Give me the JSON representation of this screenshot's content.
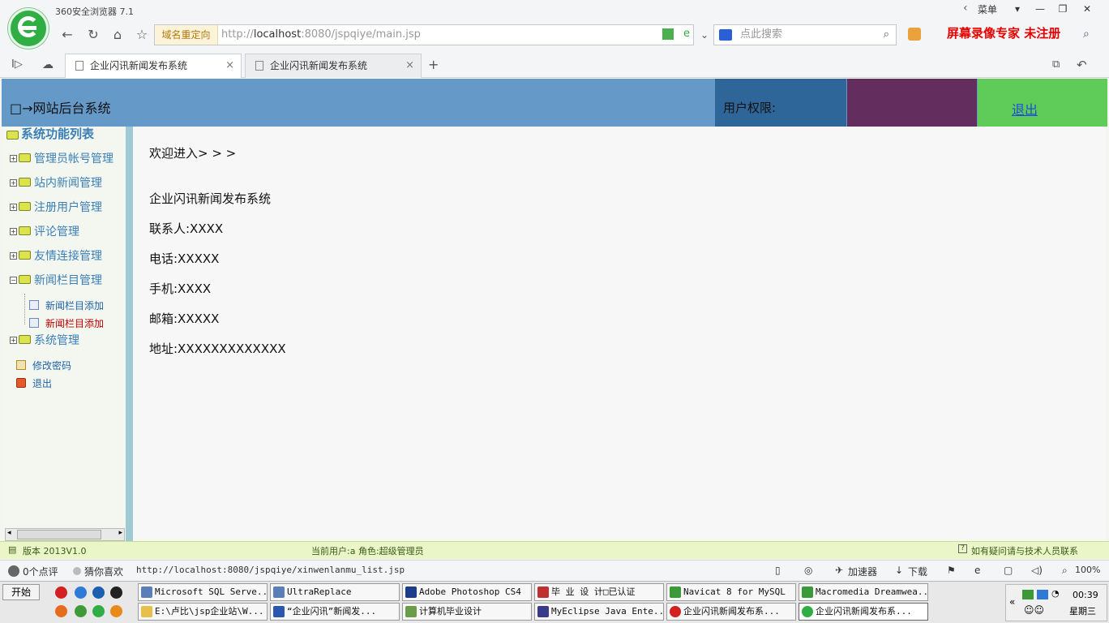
{
  "browser": {
    "app_title": "360安全浏览器 7.1",
    "menu_label": "菜单",
    "recorder_watermark": "屏幕录像专家 未注册",
    "redirect_label": "域名重定向",
    "url_prefix": "http://",
    "url_host": "localhost",
    "url_rest": ":8080/jspqiye/main.jsp",
    "search_placeholder": "点此搜索",
    "tabs": [
      {
        "label": "企业闪讯新闻发布系统",
        "active": true
      },
      {
        "label": "企业闪讯新闻发布系统",
        "active": false
      }
    ]
  },
  "header": {
    "system_title": "□→网站后台系统",
    "rights_label": "用户权限:",
    "logout_label": "退出"
  },
  "sidebar": {
    "root_label": "系统功能列表",
    "items": [
      {
        "label": "管理员帐号管理"
      },
      {
        "label": "站内新闻管理"
      },
      {
        "label": "注册用户管理"
      },
      {
        "label": "评论管理"
      },
      {
        "label": "友情连接管理"
      },
      {
        "label": "新闻栏目管理"
      }
    ],
    "subitems": [
      {
        "label": "新闻栏目添加"
      },
      {
        "label": "新闻栏目添加"
      }
    ],
    "system_item": "系统管理",
    "change_password": "修改密码",
    "exit": "退出"
  },
  "main": {
    "welcome": "欢迎进入> > >",
    "company": "企业闪讯新闻发布系统",
    "contact": "联系人:XXXX",
    "phone": "电话:XXXXX",
    "mobile": "手机:XXXX",
    "email": "邮箱:XXXXX",
    "address": "地址:XXXXXXXXXXXXX"
  },
  "footer": {
    "version": "版本 2013V1.0",
    "current_user": "当前用户:a  角色:超级管理员",
    "help": "如有疑问请与技术人员联系"
  },
  "statusbar": {
    "likes": "0个点评",
    "guess": "猜你喜欢",
    "hover_url": "http://localhost:8080/jspqiye/xinwenlanmu_list.jsp",
    "accelerator": "加速器",
    "download": "下载",
    "zoom": "100%"
  },
  "taskbar": {
    "start": "开始",
    "items": [
      "Microsoft SQL Serve...",
      "UltraReplace",
      "Adobe Photoshop CS4",
      "毕 业 设 计□已认证",
      "Navicat 8 for MySQL",
      "Macromedia Dreamwea...",
      "E:\\卢比\\jsp企业站\\W...",
      "“企业闪讯”新闻发...",
      "计算机毕业设计",
      "MyEclipse Java Ente...",
      "企业闪讯新闻发布系...",
      "企业闪讯新闻发布系..."
    ],
    "clock": "00:39",
    "weekday": "星期三"
  }
}
